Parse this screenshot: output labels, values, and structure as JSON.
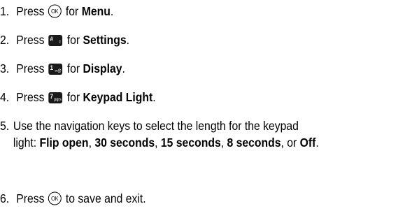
{
  "steps": [
    {
      "number": "1.",
      "pre": "Press",
      "key": "OK",
      "mid": "for",
      "target": "Menu",
      "post": "."
    },
    {
      "number": "2.",
      "pre": "Press",
      "key_main": "#",
      "key_sub": "⇧",
      "mid": "for",
      "target": "Settings",
      "post": "."
    },
    {
      "number": "3.",
      "pre": "Press",
      "key_main": "1",
      "key_sub": "∞@",
      "mid": "for",
      "target": "Display",
      "post": "."
    },
    {
      "number": "4.",
      "pre": "Press",
      "key_main": "7",
      "key_sub": "pqrs",
      "mid": "for",
      "target": "Keypad Light",
      "post": "."
    },
    {
      "number": "5.",
      "line1": "Use the navigation keys to select the length for the keypad",
      "line2_pre": "light:",
      "options": [
        "Flip open",
        "30 seconds",
        "15 seconds",
        "8 seconds",
        "Off"
      ],
      "sep_comma": ",",
      "sep_or": ", or",
      "post": "."
    },
    {
      "number": "6.",
      "pre": "Press",
      "key": "OK",
      "post": "to save and exit."
    }
  ]
}
